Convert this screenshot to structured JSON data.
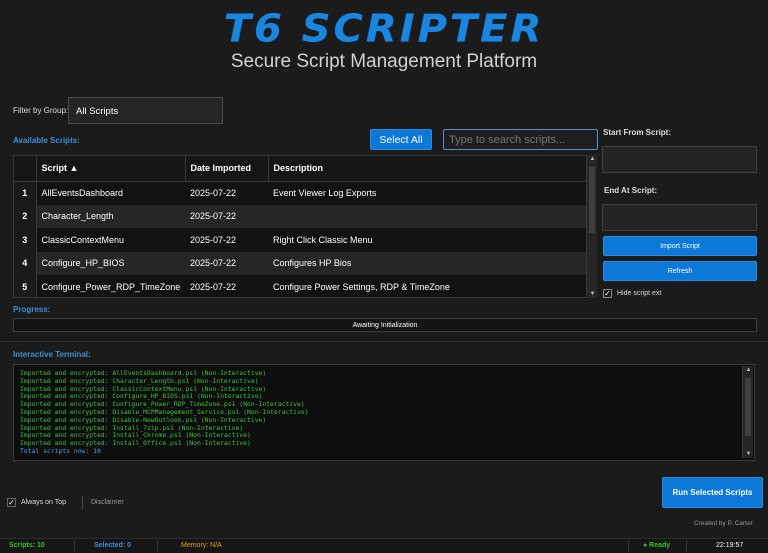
{
  "header": {
    "logo_text": "T6 SCRIPTER",
    "subtitle": "Secure Script Management Platform"
  },
  "filter": {
    "label": "Filter by Group:",
    "selected": "All Scripts"
  },
  "scripts": {
    "section_label": "Available Scripts:",
    "select_all_label": "Select All",
    "search_placeholder": "Type to search scripts...",
    "columns": [
      "Script ▲",
      "Date Imported",
      "Description"
    ],
    "rows": [
      {
        "index": "1",
        "script": "AllEventsDashboard",
        "date": "2025-07-22",
        "description": "Event Viewer Log Exports"
      },
      {
        "index": "2",
        "script": "Character_Length",
        "date": "2025-07-22",
        "description": ""
      },
      {
        "index": "3",
        "script": "ClassicContextMenu",
        "date": "2025-07-22",
        "description": "Right Click Classic Menu"
      },
      {
        "index": "4",
        "script": "Configure_HP_BIOS",
        "date": "2025-07-22",
        "description": "Configures HP Bios"
      },
      {
        "index": "5",
        "script": "Configure_Power_RDP_TimeZone",
        "date": "2025-07-22",
        "description": "Configure Power Settings, RDP & TimeZone"
      }
    ]
  },
  "right_panel": {
    "start_label": "Start From Script:",
    "end_label": "End At Script:",
    "import_label": "Import Script",
    "refresh_label": "Refresh",
    "hide_ext_label": "Hide script ext",
    "hide_ext_checked": "✓"
  },
  "progress": {
    "label": "Progress:",
    "status": "Awaiting Initialization"
  },
  "terminal": {
    "label": "Interactive Terminal:",
    "lines": [
      "Imported and encrypted: AllEventsDashboard.ps1 (Non-Interactive)",
      "Imported and encrypted: Character_Length.ps1 (Non-Interactive)",
      "Imported and encrypted: ClassicContextMenu.ps1 (Non-Interactive)",
      "Imported and encrypted: Configure_HP_BIOS.ps1 (Non-Interactive)",
      "Imported and encrypted: Configure_Power_RDP_TimeZone.ps1 (Non-Interactive)",
      "Imported and encrypted: Disable_MCPManagement_Service.ps1 (Non-Interactive)",
      "Imported and encrypted: Disable-NewOutlook.ps1 (Non-Interactive)",
      "Imported and encrypted: Install_7zip.ps1 (Non-Interactive)",
      "Imported and encrypted: Install_Chrome.ps1 (Non-Interactive)",
      "Imported and encrypted: Install_Office.ps1 (Non-Interactive)"
    ],
    "total_line": "Total scripts now: 10"
  },
  "footer": {
    "always_on_top_label": "Always on Top",
    "always_on_top_checked": "✓",
    "disclaimer_label": "Disclaimer",
    "run_label": "Run Selected Scripts",
    "credit": "Created by P. Carter"
  },
  "statusbar": {
    "scripts": "Scripts: 10",
    "selected": "Selected: 0",
    "memory": "Memory: N/A",
    "ready": "● Ready",
    "time": "22:19:57"
  },
  "colors": {
    "accent": "#0c78d8",
    "label_blue": "#3b8fd6",
    "terminal_green": "#3cc13c",
    "status_green": "#2fc12f",
    "status_blue": "#3b8fd6",
    "status_orange": "#e0a020"
  }
}
